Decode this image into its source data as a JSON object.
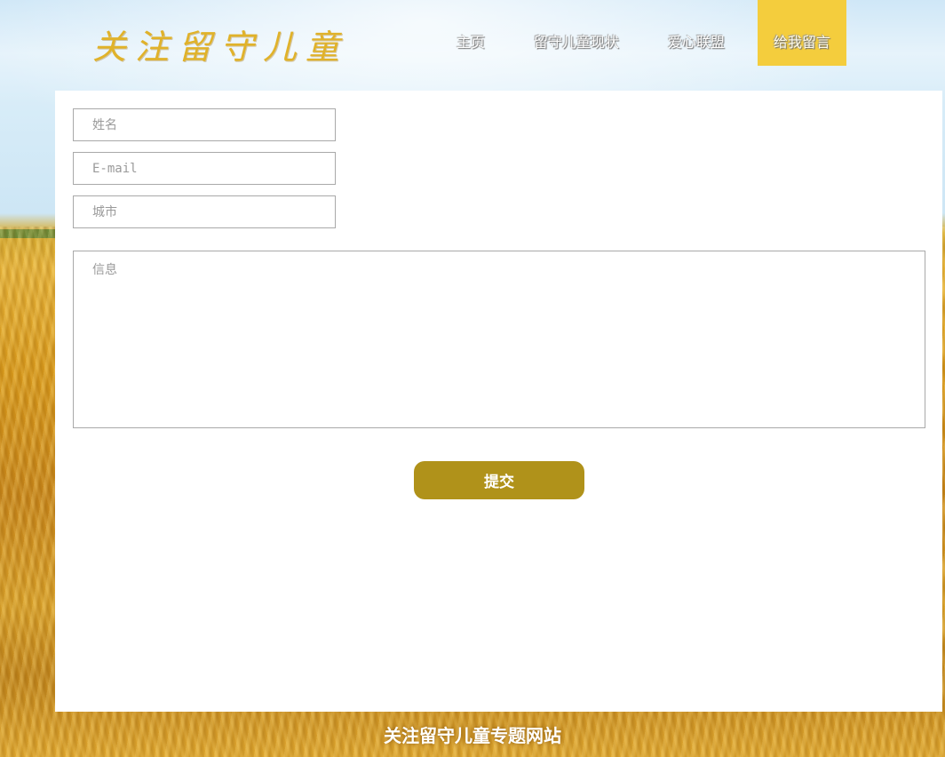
{
  "header": {
    "logo_text": "关注留守儿童",
    "nav": [
      {
        "label": "主页",
        "active": false
      },
      {
        "label": "留守儿童现状",
        "active": false
      },
      {
        "label": "爱心联盟",
        "active": false
      },
      {
        "label": "给我留言",
        "active": true
      }
    ]
  },
  "form": {
    "name_placeholder": "姓名",
    "email_placeholder": "E-mail",
    "city_placeholder": "城市",
    "message_placeholder": "信息",
    "submit_label": "提交"
  },
  "footer": {
    "text": "关注留守儿童专题网站"
  },
  "colors": {
    "accent": "#f4cd3d",
    "submit": "#b0921a",
    "logo": "#e0b22a"
  }
}
